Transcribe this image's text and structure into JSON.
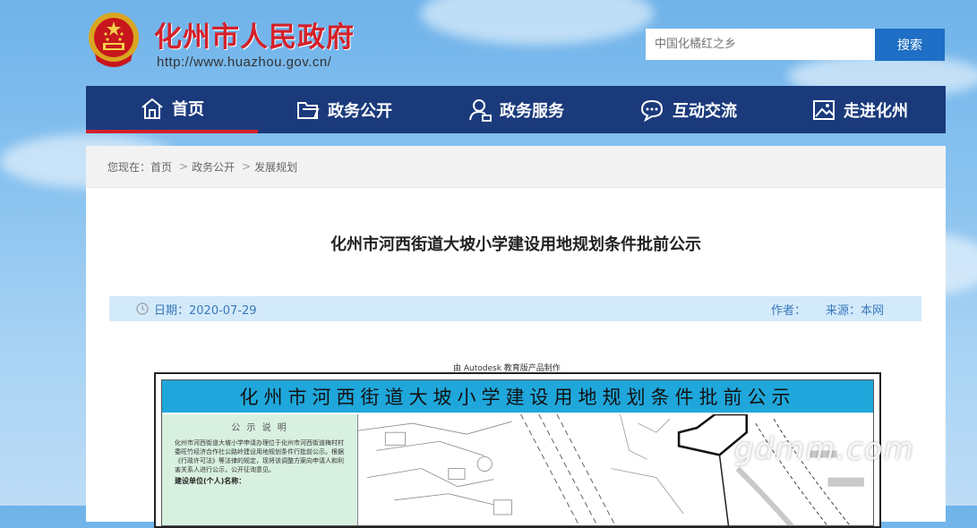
{
  "header": {
    "site_title": "化州市人民政府",
    "site_url": "http://www.huazhou.gov.cn/",
    "search_placeholder": "中国化橘红之乡",
    "search_button": "搜索"
  },
  "nav": {
    "items": [
      {
        "label": "首页",
        "icon": "home-icon",
        "active": true
      },
      {
        "label": "政务公开",
        "icon": "folder-icon"
      },
      {
        "label": "政务服务",
        "icon": "user-service-icon"
      },
      {
        "label": "互动交流",
        "icon": "chat-icon"
      },
      {
        "label": "走进化州",
        "icon": "picture-icon"
      }
    ]
  },
  "breadcrumb": {
    "prefix": "您现在：",
    "items": [
      "首页",
      "政务公开",
      "发展规划"
    ],
    "separator": ">"
  },
  "article": {
    "title": "化州市河西街道大坡小学建设用地规划条件批前公示",
    "date_label": "日期：2020-07-29",
    "author_label": "作者：",
    "source_label": "来源：本网"
  },
  "document": {
    "caption": "由 Autodesk 教育版产品制作",
    "plan_title": "化州市河西街道大坡小学建设用地规划条件批前公示",
    "notice_heading": "公 示 说 明",
    "notice_text": "化州市河西街道大坡小学申请办理位于化州市河西街道梅村村委旺竹经济合作社公路岭建设用地规划条件行批前公示。根据《行政许可法》等法律的规定，现将该调整方案向申请人和利害关系人进行公示，公开征询意见。",
    "notice_unit": "建设单位(个人)名称："
  },
  "watermark": "gdmm.com",
  "colors": {
    "brand_red": "#d4212a",
    "nav_bg": "#1b3a7c",
    "search_btn": "#1e6fc5",
    "meta_bar": "#d3eafb",
    "plan_title_bg": "#1fa7db",
    "notice_bg": "#d8f0e0"
  }
}
